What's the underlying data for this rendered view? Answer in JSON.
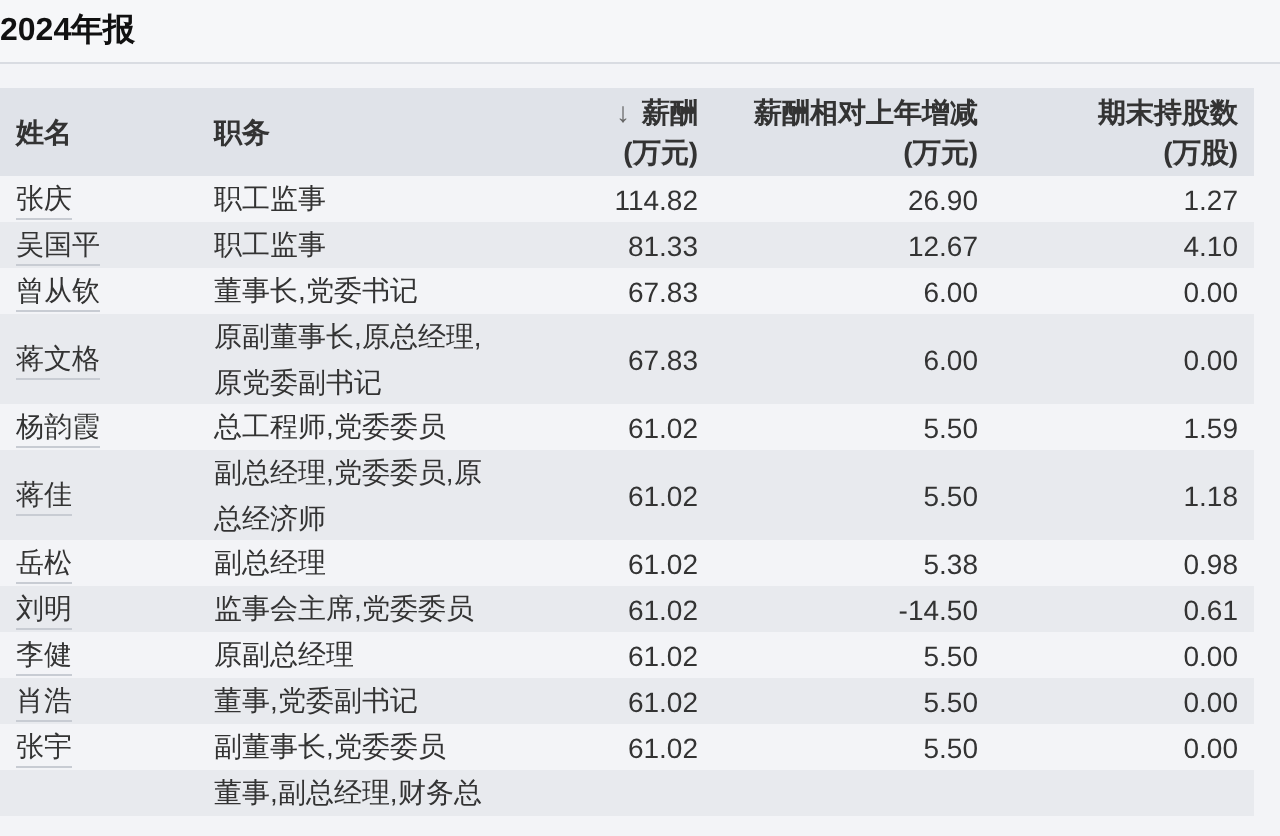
{
  "title": "2024年报",
  "table": {
    "columns": [
      {
        "label": "姓名"
      },
      {
        "label": "职务"
      },
      {
        "label": "薪酬",
        "unit": "(万元)",
        "sort": "↓"
      },
      {
        "label": "薪酬相对上年增减",
        "unit": "(万元)"
      },
      {
        "label": "期末持股数",
        "unit": "(万股)"
      }
    ],
    "rows": [
      {
        "name": "张庆",
        "duty": [
          "职工监事"
        ],
        "salary": "114.82",
        "change": "26.90",
        "shares": "1.27"
      },
      {
        "name": "吴国平",
        "duty": [
          "职工监事"
        ],
        "salary": "81.33",
        "change": "12.67",
        "shares": "4.10"
      },
      {
        "name": "曾从钦",
        "duty": [
          "董事长,党委书记"
        ],
        "salary": "67.83",
        "change": "6.00",
        "shares": "0.00"
      },
      {
        "name": "蒋文格",
        "duty": [
          "原副董事长,原总经理,",
          "原党委副书记"
        ],
        "salary": "67.83",
        "change": "6.00",
        "shares": "0.00"
      },
      {
        "name": "杨韵霞",
        "duty": [
          "总工程师,党委委员"
        ],
        "salary": "61.02",
        "change": "5.50",
        "shares": "1.59"
      },
      {
        "name": "蒋佳",
        "duty": [
          "副总经理,党委委员,原",
          "总经济师"
        ],
        "salary": "61.02",
        "change": "5.50",
        "shares": "1.18"
      },
      {
        "name": "岳松",
        "duty": [
          "副总经理"
        ],
        "salary": "61.02",
        "change": "5.38",
        "shares": "0.98"
      },
      {
        "name": "刘明",
        "duty": [
          "监事会主席,党委委员"
        ],
        "salary": "61.02",
        "change": "-14.50",
        "shares": "0.61"
      },
      {
        "name": "李健",
        "duty": [
          "原副总经理"
        ],
        "salary": "61.02",
        "change": "5.50",
        "shares": "0.00"
      },
      {
        "name": "肖浩",
        "duty": [
          "董事,党委副书记"
        ],
        "salary": "61.02",
        "change": "5.50",
        "shares": "0.00"
      },
      {
        "name": "张宇",
        "duty": [
          "副董事长,党委委员"
        ],
        "salary": "61.02",
        "change": "5.50",
        "shares": "0.00"
      },
      {
        "duty": [
          "董事,副总经理,财务总"
        ]
      }
    ]
  }
}
